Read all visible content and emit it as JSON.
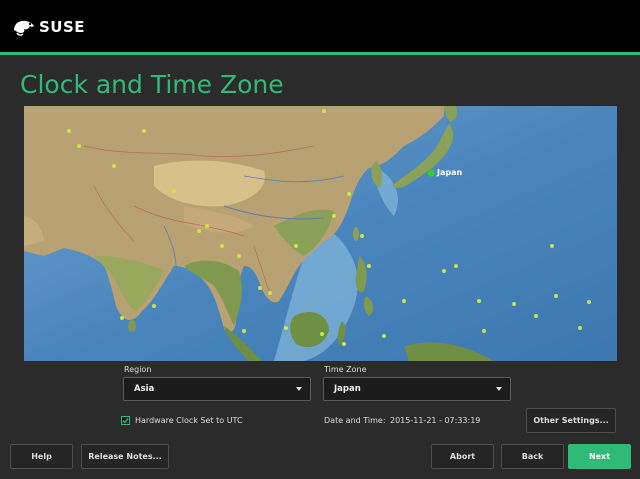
{
  "header": {
    "logo_text": "SUSE"
  },
  "page": {
    "title": "Clock and Time Zone"
  },
  "map": {
    "selected_marker": "Japan",
    "water_color": "#4a86bd",
    "land_color": "#b8a173",
    "marker_color": "#c8e64c"
  },
  "region": {
    "label": "Region",
    "value": "Asia"
  },
  "timezone": {
    "label": "Time Zone",
    "value": "Japan"
  },
  "hardware_clock": {
    "label": "Hardware Clock Set to UTC",
    "checked": true
  },
  "datetime": {
    "label": "Date and Time:",
    "value": "2015-11-21 - 07:33:19"
  },
  "buttons": {
    "other_settings": "Other Settings...",
    "help": "Help",
    "release_notes": "Release Notes...",
    "abort": "Abort",
    "back": "Back",
    "next": "Next"
  },
  "colors": {
    "accent": "#30ba78",
    "background": "#2b2b2b",
    "header": "#000000"
  }
}
